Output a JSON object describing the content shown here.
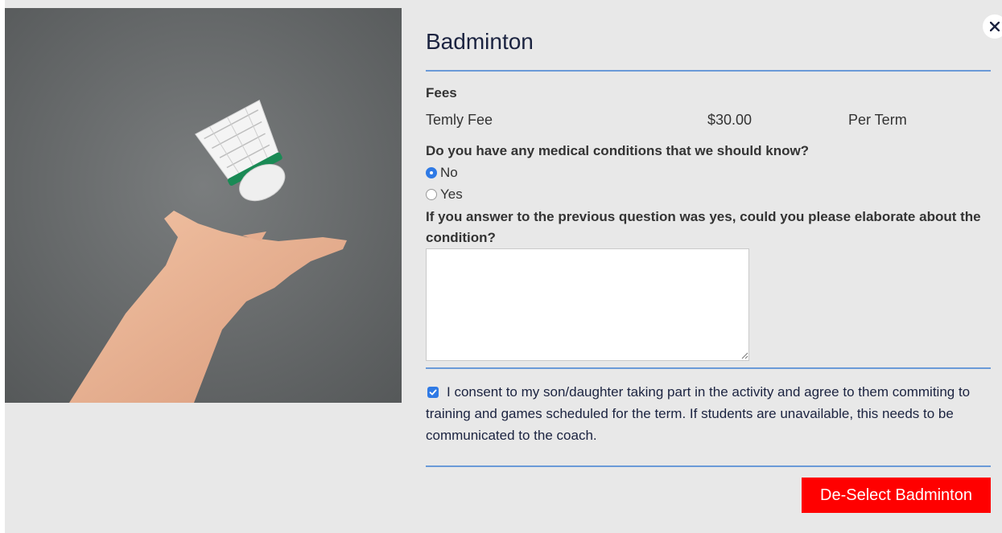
{
  "modal": {
    "title": "Badminton",
    "close_icon": "close-icon"
  },
  "fees": {
    "label": "Fees",
    "items": [
      {
        "name": "Temly Fee",
        "amount": "$30.00",
        "period": "Per Term"
      }
    ]
  },
  "medical": {
    "question": "Do you have any medical conditions that we should know?",
    "options": [
      {
        "label": "No",
        "checked": true
      },
      {
        "label": "Yes",
        "checked": false
      }
    ],
    "elaborate_question": "If you answer to the previous question was yes, could you please elaborate about the condition?",
    "elaborate_value": ""
  },
  "consent": {
    "checked": true,
    "text": "I consent to my son/daughter taking part in the activity and agree to them commiting to training and games scheduled for the term. If students are unavailable, this needs to be communicated to the coach."
  },
  "actions": {
    "deselect_label": "De-Select Badminton"
  },
  "colors": {
    "accent": "#2f7ae5",
    "rule": "#6a9ad8",
    "danger": "#ff0000",
    "background": "#e8e8e8",
    "title": "#1b2340"
  }
}
